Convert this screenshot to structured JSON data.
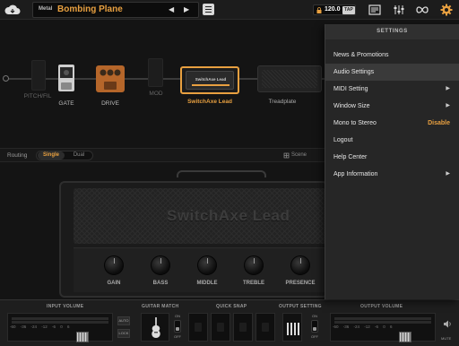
{
  "topbar": {
    "preset_category": "Metal",
    "preset_name": "Bombing Plane",
    "prev_symbol": "◀",
    "next_symbol": "▶",
    "tempo": "120.0",
    "tap_label": "TAP"
  },
  "chain": {
    "blocks": [
      {
        "label": "PITCH/FIL",
        "state": "empty"
      },
      {
        "label": "GATE",
        "state": "active"
      },
      {
        "label": "DRIVE",
        "state": "active"
      },
      {
        "label": "MOD",
        "state": "empty"
      },
      {
        "label": "SwitchAxe Lead",
        "state": "selected",
        "badge": "SwitchAxe Lead"
      },
      {
        "label": "Treadplate",
        "state": "active"
      }
    ]
  },
  "routing": {
    "label": "Routing",
    "single": "Single",
    "dual": "Dual",
    "scene": "Scene"
  },
  "amp": {
    "name": "SwitchAxe Lead",
    "knobs": [
      "GAIN",
      "BASS",
      "MIDDLE",
      "TREBLE",
      "PRESENCE"
    ]
  },
  "settings": {
    "title": "SETTINGS",
    "items": [
      {
        "label": "News & Promotions"
      },
      {
        "label": "Audio Settings",
        "highlighted": true
      },
      {
        "label": "MIDI Setting",
        "arrow": "▶"
      },
      {
        "label": "Window Size",
        "arrow": "▶"
      },
      {
        "label": "Mono to Stereo",
        "value": "Disable"
      },
      {
        "label": "Logout"
      },
      {
        "label": "Help Center"
      },
      {
        "label": "App Information",
        "arrow": "▶"
      }
    ]
  },
  "bottom": {
    "input_volume": "INPUT VOLUME",
    "guitar_match": "GUITAR MATCH",
    "quick_snap": "QUICK SNAP",
    "output_setting": "OUTPUT SETTING",
    "output_volume": "OUTPUT VOLUME",
    "meter_ticks": "-60 -36 -24 -12 -6 0 6",
    "auto": "AUTO",
    "lock": "LOCK",
    "on": "ON",
    "off": "OFF",
    "mute": "MUTE"
  },
  "colors": {
    "accent": "#e8a040",
    "background": "#141414",
    "panel": "#262626"
  }
}
